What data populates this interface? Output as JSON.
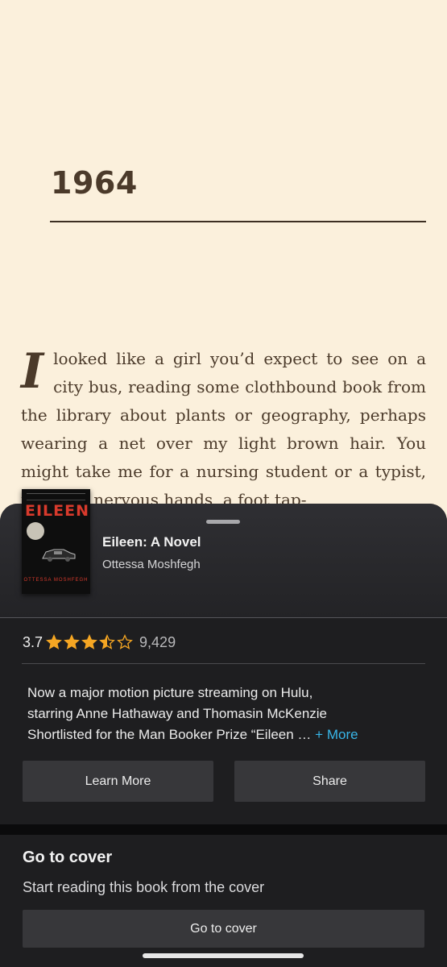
{
  "reader": {
    "chapter_title": "1964",
    "drop_cap": "I",
    "lines": [
      "looked like a girl you’d expect to see on a",
      "city bus, reading some clothbound book",
      "from the library about plants or geography,",
      "perhaps wearing a net over my light brown",
      "hair. You might take me for a nursing student",
      "or a typist, note the nervous hands, a foot tap-"
    ]
  },
  "book": {
    "title": "Eileen: A Novel",
    "author": "Ottessa Moshfegh",
    "cover_title": "EILEEN",
    "cover_author": "OTTESSA MOSHFEGH",
    "rating": "3.7",
    "rating_value": 3.7,
    "star_color": "#f5a623",
    "rating_count": "9,429",
    "description_lines": [
      "Now a major motion picture streaming on Hulu,",
      "starring Anne Hathaway and Thomasin McKenzie",
      "Shortlisted for the Man Booker Prize “Eileen …"
    ],
    "more_label": "+ More",
    "more_color": "#38b6e8"
  },
  "actions": {
    "learn_more": "Learn More",
    "share": "Share"
  },
  "goto_cover": {
    "title": "Go to cover",
    "subtitle": "Start reading this book from the cover",
    "button": "Go to cover"
  }
}
